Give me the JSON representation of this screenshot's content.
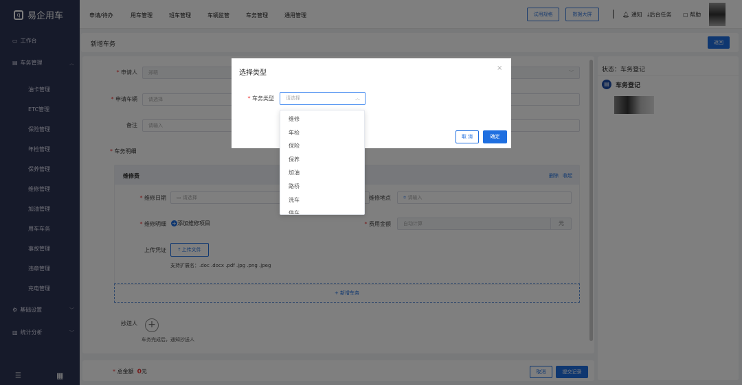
{
  "app": {
    "name": "易企用车"
  },
  "sidebar": {
    "items": [
      {
        "label": "工作台"
      },
      {
        "label": "车务管理"
      },
      {
        "label": "基础设置"
      },
      {
        "label": "统计分析"
      }
    ],
    "sub_items": [
      "油卡管理",
      "ETC管理",
      "保险管理",
      "年检管理",
      "保养管理",
      "维修管理",
      "加油管理",
      "用车车务",
      "事故管理",
      "违章管理",
      "充电管理"
    ]
  },
  "topnav": {
    "items": [
      "申请/待办",
      "用车管理",
      "班车管理",
      "车辆监管",
      "车务管理",
      "通用管理"
    ],
    "trial_label": "试用规格",
    "screen_label": "数据大屏",
    "notify": "通知",
    "tasks": "后台任务",
    "help": "帮助"
  },
  "page": {
    "title": "新增车务",
    "back_label": "返回"
  },
  "form": {
    "applicant_label": "申请人",
    "applicant_value": "郑萌",
    "vehicle_label": "申请车辆",
    "vehicle_placeholder": "请选择",
    "remark_label": "备注",
    "remark_placeholder": "请输入",
    "detail_label": "车务明细",
    "section": {
      "title": "维修费",
      "delete": "删除",
      "collapse": "收起",
      "date_label": "维修日期",
      "date_placeholder": "请选择",
      "place_label": "维修地点",
      "place_placeholder": "请输入",
      "items_label": "维修明细",
      "add_items": "添加维修项目",
      "amount_label": "费用金额",
      "amount_placeholder": "自动计算",
      "amount_unit": "元",
      "upload_label": "上传凭证",
      "upload_button": "上传文件",
      "upload_hint": "支持扩展名：.doc .docx .pdf .jpg .png .jpeg"
    },
    "add_service": "+ 新增车务",
    "cc_label": "抄送人",
    "cc_hint": "车务完成后，通知抄送人"
  },
  "footer": {
    "total_label": "总金额",
    "total_value": "0",
    "total_unit": "元",
    "cancel": "取消",
    "submit": "提交记录"
  },
  "right_panel": {
    "status": "状态：车务登记",
    "step": "车务登记"
  },
  "modal": {
    "title": "选择类型",
    "field_label": "车务类型",
    "placeholder": "请选择",
    "cancel": "取 消",
    "confirm": "确定",
    "options": [
      "维修",
      "年检",
      "保险",
      "保养",
      "加油",
      "路桥",
      "洗车",
      "停车"
    ]
  },
  "colors": {
    "primary": "#1f6fe0",
    "sidebar": "#2c3454",
    "required": "#e33333"
  }
}
